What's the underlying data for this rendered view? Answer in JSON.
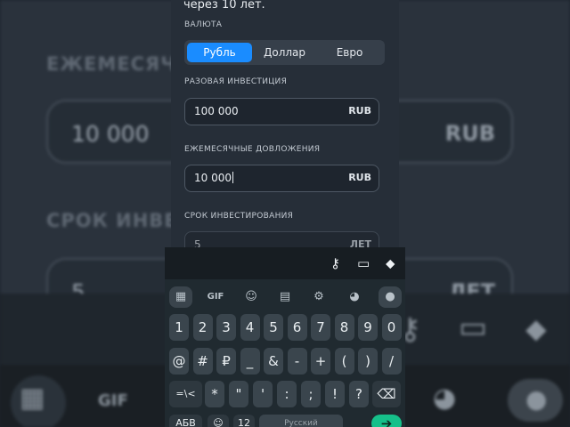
{
  "app": {
    "header_text": "через 10 лет.",
    "currency": {
      "label": "ВАЛЮТА",
      "options": [
        "Рубль",
        "Доллар",
        "Евро"
      ],
      "selected": "Рубль"
    },
    "initial_investment": {
      "label": "РАЗОВАЯ ИНВЕСТИЦИЯ",
      "value": "100 000",
      "unit": "RUB"
    },
    "monthly_contribution": {
      "label": "ЕЖЕМЕСЯЧНЫЕ ДОВЛОЖЕНИЯ",
      "value": "10 000",
      "unit": "RUB"
    },
    "term": {
      "label": "СРОК ИНВЕСТИРОВАНИЯ",
      "value": "5",
      "unit": "ЛЕТ"
    }
  },
  "background": {
    "label_monthly": "ЕЖЕМЕСЯЧН",
    "label_term": "СРОК ИНВЕС",
    "field_value": "10 000",
    "field_unit": "RUB",
    "term_value": "5",
    "term_unit": "ЛЕТ",
    "kb_gif": "GIF",
    "kb_abc": "АБВ"
  },
  "keyboard": {
    "toolbar_gif": "GIF",
    "digits": [
      "1",
      "2",
      "3",
      "4",
      "5",
      "6",
      "7",
      "8",
      "9",
      "0"
    ],
    "symbols_row": [
      "@",
      "#",
      "₽",
      "_",
      "&",
      "-",
      "+",
      "(",
      ")",
      "/"
    ],
    "punct_row": [
      "*",
      "\"",
      "'",
      ":",
      ";",
      "!",
      "?"
    ],
    "shift_label": "=\\<",
    "abc_label": "АБВ",
    "num_label": "12",
    "space_label": "Русский",
    "icons": {
      "key": "key-icon",
      "card": "credit-card-icon",
      "pin": "location-pin-icon"
    },
    "accent_color": "#16c08a"
  },
  "colors": {
    "accent": "#1a8cff",
    "background": "#262e38"
  }
}
